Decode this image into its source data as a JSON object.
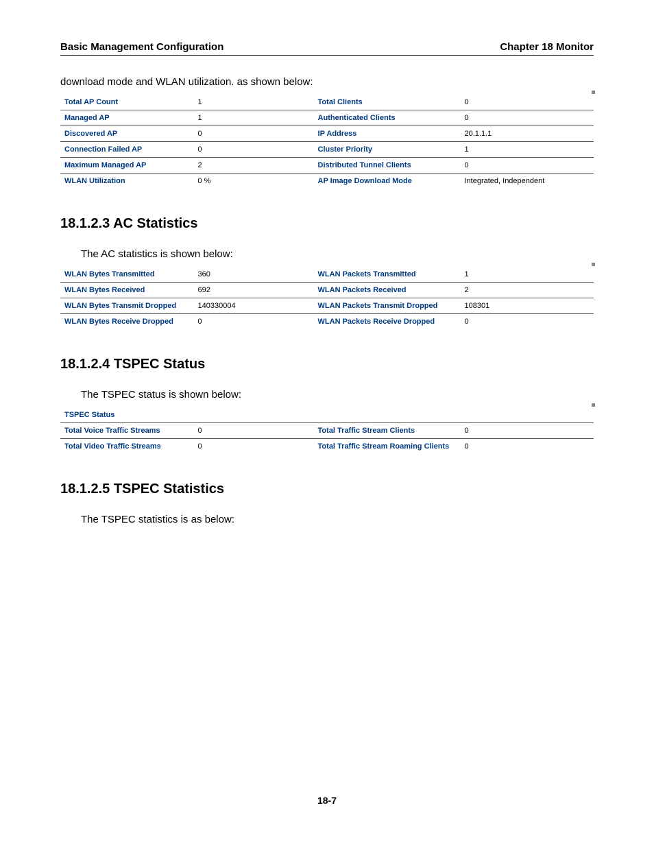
{
  "header": {
    "left": "Basic Management Configuration",
    "right": "Chapter 18 Monitor"
  },
  "intro": "download mode and WLAN utilization. as shown below:",
  "t1": {
    "r0": {
      "l1": "Total AP Count",
      "v1": "1",
      "l2": "Total Clients",
      "v2": "0"
    },
    "r1": {
      "l1": "Managed AP",
      "v1": "1",
      "l2": "Authenticated Clients",
      "v2": "0"
    },
    "r2": {
      "l1": "Discovered AP",
      "v1": "0",
      "l2": "IP Address",
      "v2": "20.1.1.1"
    },
    "r3": {
      "l1": "Connection Failed AP",
      "v1": "0",
      "l2": "Cluster Priority",
      "v2": "1"
    },
    "r4": {
      "l1": "Maximum Managed AP",
      "v1": "2",
      "l2": "Distributed Tunnel Clients",
      "v2": "0"
    },
    "r5": {
      "l1": "WLAN Utilization",
      "v1": "0 %",
      "l2": "AP Image Download Mode",
      "v2": "Integrated, Independent"
    }
  },
  "sec1": {
    "head": "18.1.2.3 AC Statistics",
    "body": "The AC statistics is shown below:"
  },
  "t2": {
    "r0": {
      "l1": "WLAN Bytes Transmitted",
      "v1": "360",
      "l2": "WLAN Packets Transmitted",
      "v2": "1"
    },
    "r1": {
      "l1": "WLAN Bytes Received",
      "v1": "692",
      "l2": "WLAN Packets Received",
      "v2": "2"
    },
    "r2": {
      "l1": "WLAN Bytes Transmit Dropped",
      "v1": "140330004",
      "l2": "WLAN Packets Transmit Dropped",
      "v2": "108301"
    },
    "r3": {
      "l1": "WLAN Bytes Receive Dropped",
      "v1": "0",
      "l2": "WLAN Packets Receive Dropped",
      "v2": "0"
    }
  },
  "sec2": {
    "head": "18.1.2.4 TSPEC Status",
    "body": "The TSPEC status is shown below:"
  },
  "t3": {
    "title": "TSPEC Status",
    "r0": {
      "l1": "Total Voice Traffic Streams",
      "v1": "0",
      "l2": "Total Traffic Stream Clients",
      "v2": "0"
    },
    "r1": {
      "l1": "Total Video Traffic Streams",
      "v1": "0",
      "l2": "Total Traffic Stream Roaming Clients",
      "v2": "0"
    }
  },
  "sec3": {
    "head": "18.1.2.5 TSPEC Statistics",
    "body": "The TSPEC statistics is as below:"
  },
  "pagenum": "18-7"
}
